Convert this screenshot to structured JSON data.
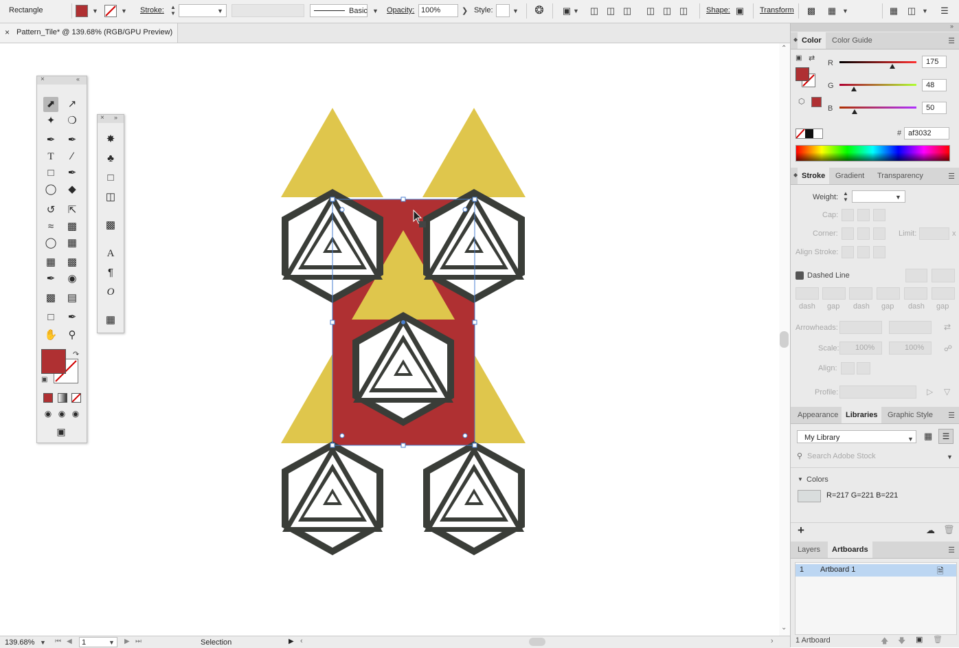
{
  "control_bar": {
    "object_type": "Rectangle",
    "stroke_label": "Stroke:",
    "brush_label": "Basic",
    "opacity_label": "Opacity:",
    "opacity_value": "100%",
    "style_label": "Style:",
    "shape_label": "Shape:",
    "transform_label": "Transform",
    "fill_color": "#af3032"
  },
  "document_tab": {
    "title": "Pattern_Tile* @ 139.68% (RGB/GPU Preview)",
    "close": "×"
  },
  "color_panel": {
    "tabs": [
      "Color",
      "Color Guide"
    ],
    "r_label": "R",
    "r_value": "175",
    "g_label": "G",
    "g_value": "48",
    "b_label": "B",
    "b_value": "50",
    "r": 175,
    "g": 48,
    "b": 50,
    "hash_label": "#",
    "hex_value": "af3032"
  },
  "stroke_panel": {
    "tabs": [
      "Stroke",
      "Gradient",
      "Transparency"
    ],
    "weight_label": "Weight:",
    "cap_label": "Cap:",
    "corner_label": "Corner:",
    "limit_label": "Limit:",
    "limit_unit": "x",
    "align_label": "Align Stroke:",
    "dashed_label": "Dashed Line",
    "dash_labels": [
      "dash",
      "gap",
      "dash",
      "gap",
      "dash",
      "gap"
    ],
    "arrowheads_label": "Arrowheads:",
    "scale_label": "Scale:",
    "scale_1": "100%",
    "scale_2": "100%",
    "align2_label": "Align:",
    "profile_label": "Profile:"
  },
  "libraries_panel": {
    "tabs": [
      "Appearance",
      "Libraries",
      "Graphic Style"
    ],
    "library_name": "My Library",
    "search_placeholder": "Search Adobe Stock",
    "colors_header": "Colors",
    "color_item": "R=217 G=221 B=221",
    "add_label": "+"
  },
  "layers_panel": {
    "tabs": [
      "Layers",
      "Artboards"
    ],
    "row_number": "1",
    "row_name": "Artboard 1",
    "footer": "1 Artboard"
  },
  "status_bar": {
    "zoom": "139.68%",
    "artboard_number": "1",
    "tool_name": "Selection"
  },
  "colors": {
    "red": "#af3032",
    "yellow": "#dfc64c",
    "dark": "#3a3d38",
    "selection": "#4a7fd0"
  }
}
